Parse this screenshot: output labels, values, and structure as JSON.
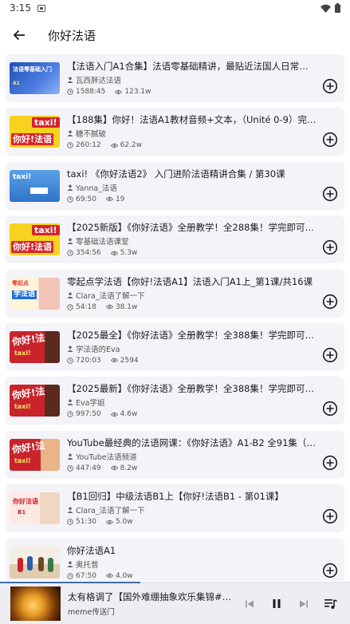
{
  "status_bar": {
    "time": "3:15"
  },
  "header": {
    "title": "你好法语"
  },
  "videos": [
    {
      "title": "【法语入门A1合集】法语零基础精讲，最贴近法国人日常生活的…",
      "author": "瓦西胖达法语",
      "duration": "1588:45",
      "views": "123.1w",
      "thumb_text": "法语零基础入门"
    },
    {
      "title": "【188集】你好！法语A1教材音频+文本，（Unité 0-9）完整版",
      "author": "糖不腻破",
      "duration": "260:12",
      "views": "62.2w",
      "thumb_text": "你好!法语"
    },
    {
      "title": "taxi! 《你好法语2》 入门进阶法语精讲合集 / 第30课",
      "author": "Yanna_法语",
      "duration": "69:50",
      "views": "19",
      "thumb_text": "taxi!"
    },
    {
      "title": "【2025新版】《你好法语》全册教学！全288集！学完即可交流…",
      "author": "零基础法语课堂",
      "duration": "354:56",
      "views": "5.3w",
      "thumb_text": "你好!法语"
    },
    {
      "title": "零起点学法语【你好!法语A1】法语入门A1上_第1课/共16课",
      "author": "Clara_法语了解一下",
      "duration": "54:18",
      "views": "38.1w",
      "thumb_text": "学法语"
    },
    {
      "title": "【2025最全】《你好法语》全册教学！全388集！学完即可交流…",
      "author": "学法语的Eva",
      "duration": "720:03",
      "views": "2594",
      "thumb_text": "你好!法"
    },
    {
      "title": "【2025最新】《你好法语》全册教学！全388集！学完即可交流…",
      "author": "Eva学姐",
      "duration": "997:50",
      "views": "4.6w",
      "thumb_text": "你好!法"
    },
    {
      "title": "YouTube最经典的法语网课：《你好法语》A1-B2 全91集（附法…",
      "author": "YouTube法语频道",
      "duration": "447:49",
      "views": "8.2w",
      "thumb_text": "你好!法"
    },
    {
      "title": "【B1回归】中级法语B1上【你好!法语B1 - 第01课】",
      "author": "Clara_法语了解一下",
      "duration": "51:30",
      "views": "5.0w",
      "thumb_text": "你好法语"
    },
    {
      "title": "你好法语A1",
      "author": "奥托普",
      "duration": "67:50",
      "views": "4.0w",
      "thumb_text": ""
    }
  ],
  "now_playing": {
    "title": "太有格调了【国外难绷抽象欢乐集锦#1…",
    "artist": "meme传送门",
    "progress_fraction": 0.4
  },
  "colors": {
    "accent": "#3a6ea5",
    "card_bg": "#f4f3f7",
    "player_bg": "#eeedf1"
  }
}
